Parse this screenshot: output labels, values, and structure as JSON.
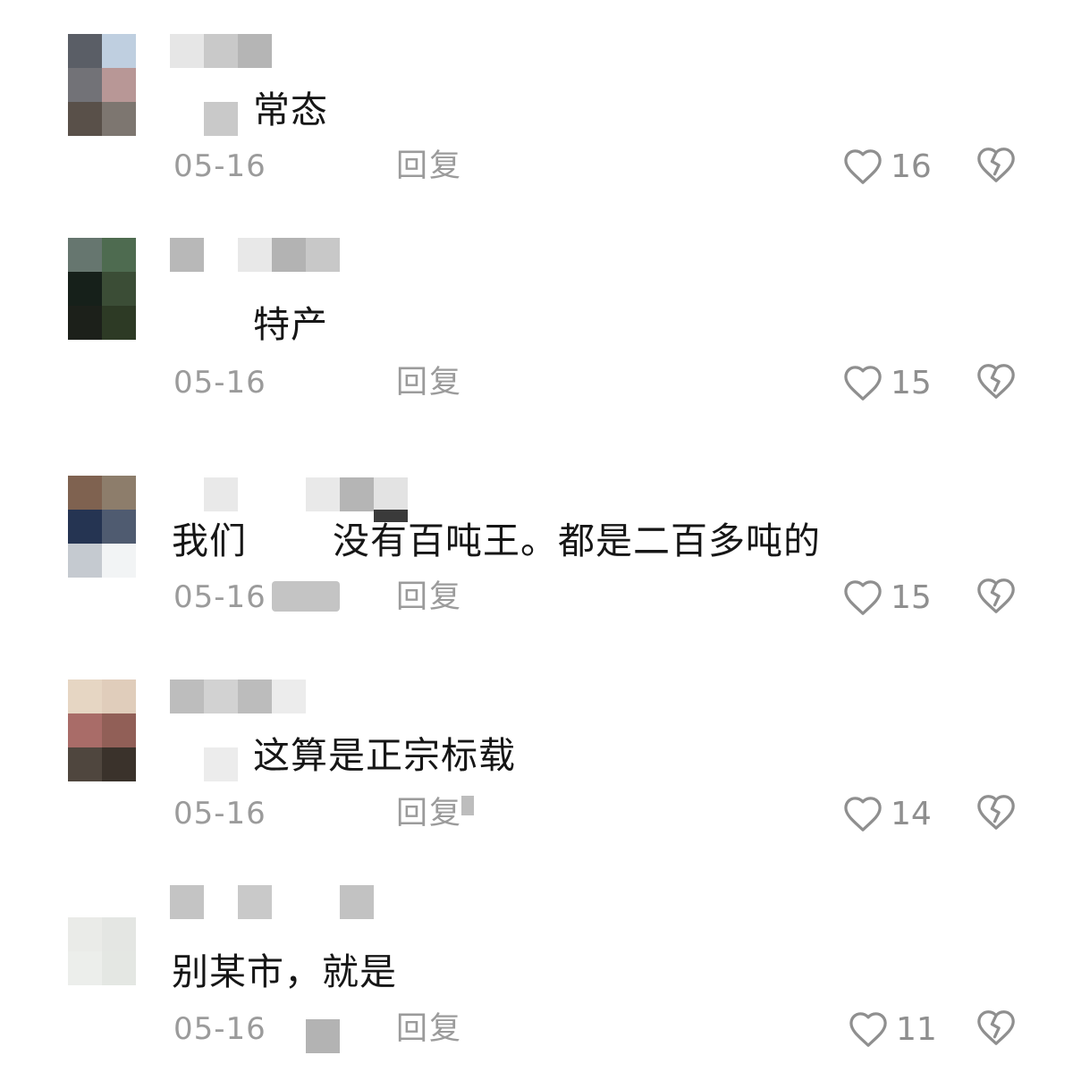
{
  "comments": [
    {
      "text": "常态",
      "date": "05-16",
      "reply_label": "回复",
      "likes": "16",
      "avatar_colors": [
        "#5a5e66",
        "#bfcfe0",
        "#727277",
        "#b89796",
        "#595049",
        "#7d7670"
      ],
      "name_colors": [
        "#e6e6e6",
        "#c9c9c9",
        "#b5b5b5"
      ]
    },
    {
      "text": "特产",
      "date": "05-16",
      "reply_label": "回复",
      "likes": "15",
      "avatar_colors": [
        "#66766f",
        "#4e6b50",
        "#16201a",
        "#3b4d36",
        "#1c201a",
        "#2d3a25"
      ],
      "name_colors": [
        "#b8b8b8",
        "#ffffff",
        "#e8e8e8",
        "#b3b3b3",
        "#c8c8c8"
      ]
    },
    {
      "text_parts": [
        "我们",
        "没有百吨王。都是二百多吨的"
      ],
      "date": "05-16",
      "reply_label": "回复",
      "likes": "15",
      "avatar_colors": [
        "#7f6250",
        "#8d7d6b",
        "#253452",
        "#4f5b70",
        "#c5cad0",
        "#f2f4f5"
      ],
      "name_colors": [
        "#e9e9e9",
        "#b5b5b5",
        "#e3e3e3"
      ]
    },
    {
      "text": "这算是正宗标载",
      "date": "05-16",
      "reply_label": "回复",
      "likes": "14",
      "avatar_colors": [
        "#e6d6c3",
        "#e0cdbb",
        "#a96c68",
        "#915f57",
        "#4f463e",
        "#3a322b"
      ],
      "name_colors": [
        "#bdbdbd",
        "#d2d2d2",
        "#bcbcbc",
        "#ececec"
      ]
    },
    {
      "text": "别某市，就是",
      "date": "05-16",
      "reply_label": "回复",
      "likes": "11",
      "avatar_colors": [
        "#ffffff",
        "#ffffff",
        "#eaebe8",
        "#e4e6e3",
        "#eceeeb",
        "#e4e7e3"
      ],
      "name_colors": [
        "#c4c4c4",
        "#c9c9c9",
        "#c2c2c2"
      ]
    }
  ]
}
